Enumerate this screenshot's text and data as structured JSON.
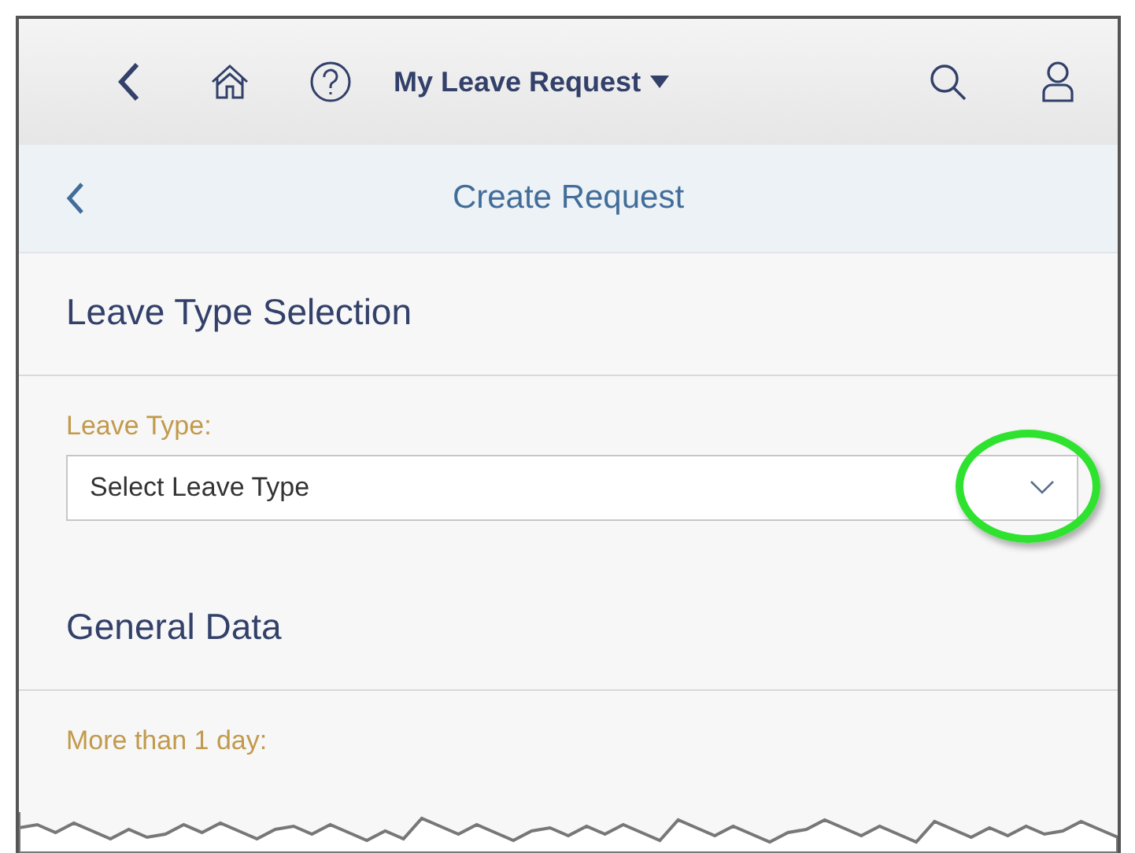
{
  "shell_bar": {
    "title": "My Leave Request"
  },
  "page_header": {
    "title": "Create Request"
  },
  "sections": [
    {
      "title": "Leave Type Selection",
      "fields": [
        {
          "label": "Leave Type:",
          "kind": "select",
          "value": "Select Leave Type",
          "highlighted": true
        }
      ]
    },
    {
      "title": "General Data",
      "fields": [
        {
          "label": "More than 1 day:",
          "kind": "label"
        }
      ]
    }
  ]
}
